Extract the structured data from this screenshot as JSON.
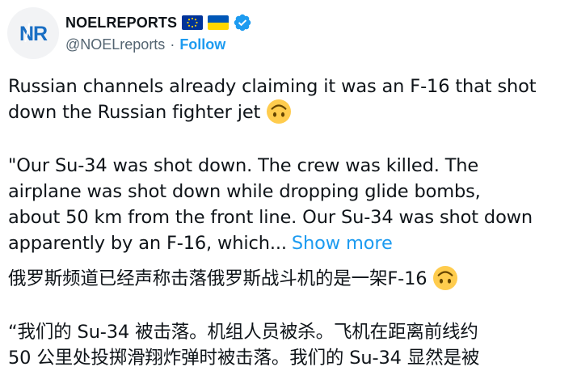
{
  "author": {
    "display_name": "NOELREPORTS",
    "avatar_letters": "NR",
    "handle": "@NOELreports",
    "separator": "·",
    "follow_label": "Follow"
  },
  "tweet": {
    "line1": "Russian channels already claiming it was an F-16 that shot",
    "line2": "down the Russian fighter jet",
    "line3": "\"Our Su-34 was shot down. The crew was killed. The",
    "line4": "airplane was shot down while dropping glide bombs,",
    "line5": "about 50 km from the front line. Our Su-34 was shot down",
    "line6": "apparently by an F-16, which...",
    "show_more": "Show more"
  },
  "translation": {
    "line1": "俄罗斯频道已经声称击落俄罗斯战斗机的是一架F-16",
    "line2": "“我们的 Su-34 被击落。机组人员被杀。飞机在距离前线约",
    "line3": "50 公里处投掷滑翔炸弹时被击落。我们的 Su-34 显然是被"
  },
  "icons": {
    "eu_flag": "eu-flag-icon",
    "ukraine_flag": "ukraine-flag-icon",
    "verified": "verified-badge-icon",
    "emoji": "upside-down-face-emoji"
  },
  "colors": {
    "link": "#1d9bf0",
    "secondary_text": "#536471",
    "text": "#0f1419",
    "avatar_blue": "#1a6fc4",
    "eu_blue": "#003399",
    "eu_star": "#ffcc00",
    "ua_blue": "#0057b7",
    "ua_yellow": "#ffd700",
    "emoji_yellow": "#ffcc4d"
  }
}
